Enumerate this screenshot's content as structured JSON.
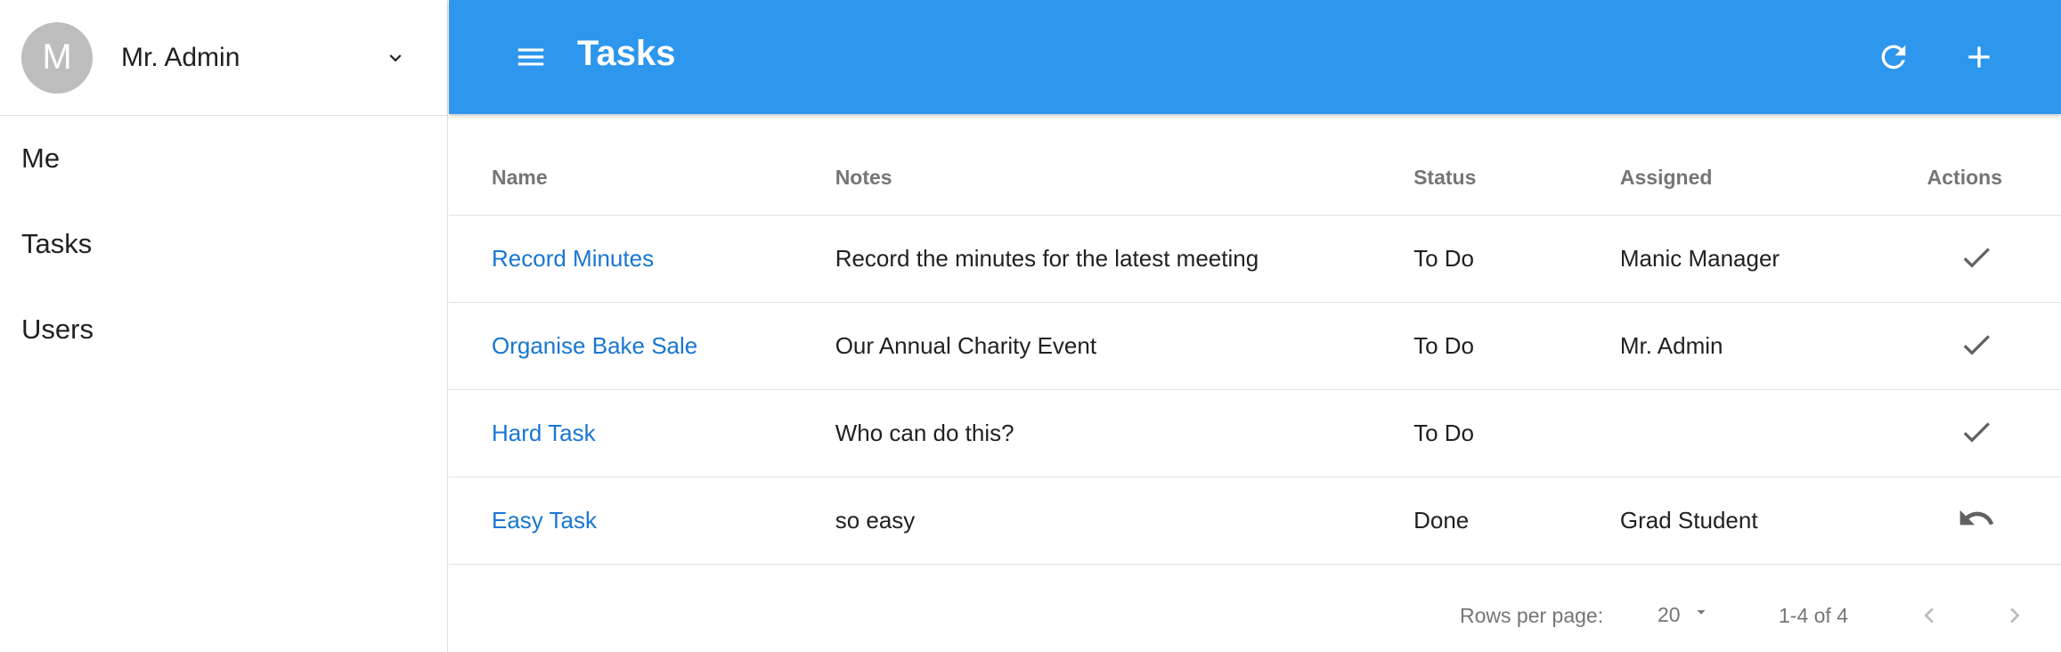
{
  "sidebar": {
    "user": {
      "avatar_initial": "M",
      "name": "Mr. Admin"
    },
    "items": [
      {
        "label": "Me"
      },
      {
        "label": "Tasks"
      },
      {
        "label": "Users"
      }
    ]
  },
  "appbar": {
    "title": "Tasks",
    "color": "#2d96ed"
  },
  "table": {
    "headers": {
      "name": "Name",
      "notes": "Notes",
      "status": "Status",
      "assigned": "Assigned",
      "actions": "Actions"
    },
    "rows": [
      {
        "name": "Record Minutes",
        "notes": "Record the minutes for the latest meeting",
        "status": "To Do",
        "assigned": "Manic Manager",
        "action_icon": "check-icon"
      },
      {
        "name": "Organise Bake Sale",
        "notes": "Our Annual Charity Event",
        "status": "To Do",
        "assigned": "Mr. Admin",
        "action_icon": "check-icon"
      },
      {
        "name": "Hard Task",
        "notes": "Who can do this?",
        "status": "To Do",
        "assigned": "",
        "action_icon": "check-icon"
      },
      {
        "name": "Easy Task",
        "notes": "so easy",
        "status": "Done",
        "assigned": "Grad Student",
        "action_icon": "undo-icon"
      }
    ]
  },
  "pagination": {
    "rows_per_page_label": "Rows per page:",
    "rows_per_page_value": "20",
    "range": "1-4 of 4"
  },
  "colors": {
    "link": "#1976d2",
    "accent": "#2d96ed"
  }
}
